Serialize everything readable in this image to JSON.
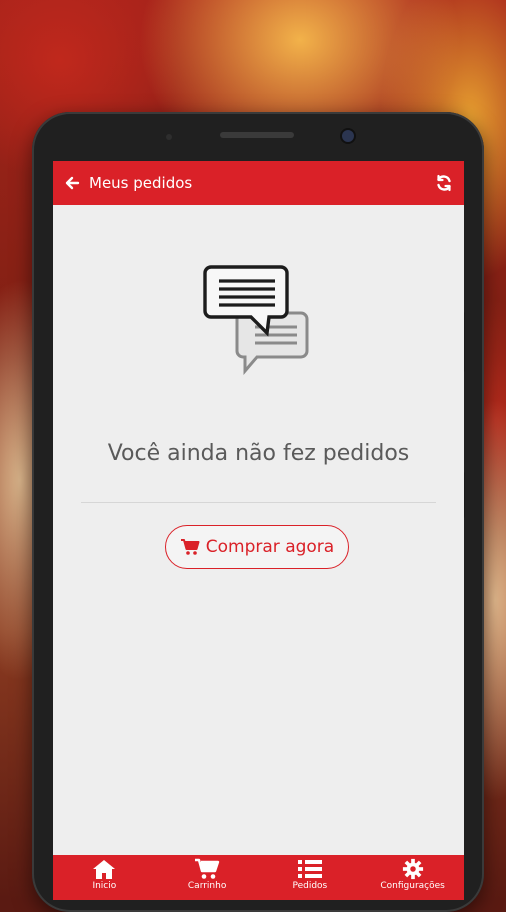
{
  "appbar": {
    "title": "Meus pedidos",
    "back_icon": "arrow-left-icon",
    "refresh_icon": "refresh-icon"
  },
  "empty_state": {
    "icon": "chat-bubbles-icon",
    "message": "Você ainda não fez pedidos",
    "button_label": "Comprar agora",
    "button_icon": "cart-icon"
  },
  "bottom_nav": [
    {
      "label": "Inicio",
      "icon": "home-icon"
    },
    {
      "label": "Carrinho",
      "icon": "cart-icon"
    },
    {
      "label": "Pedidos",
      "icon": "list-icon"
    },
    {
      "label": "Configurações",
      "icon": "gear-icon"
    }
  ],
  "colors": {
    "accent": "#da2128",
    "background": "#eeeeee",
    "text_muted": "#5a5a5a"
  }
}
